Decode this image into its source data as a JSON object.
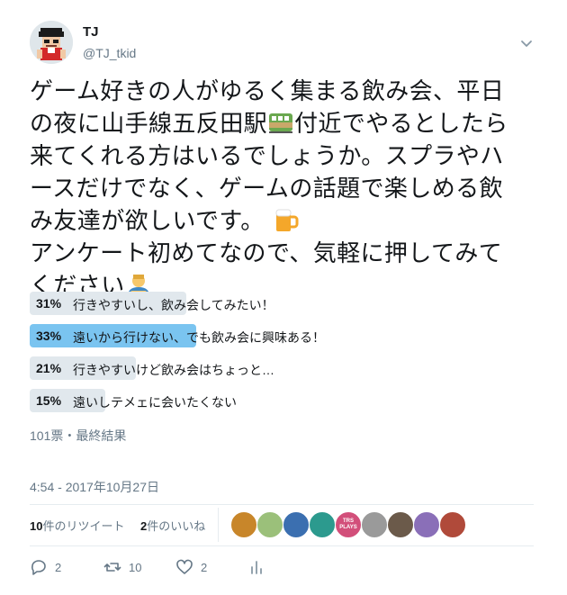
{
  "user": {
    "name": "TJ",
    "handle": "@TJ_tkid"
  },
  "tweet": {
    "lines": [
      "ゲーム好きの人がゆるく集まる飲み会、平日",
      "の夜に山手線五反田駅",
      "付近でやるとしたら",
      "来てくれる方はいるでしょうか。スプラやハ",
      "ースだけでなく、ゲームの話題で楽しめる飲",
      "み友達が欲しいです。",
      "アンケート初めてなので、気軽に押してみて",
      "ください"
    ],
    "emoji_icons": [
      "train-icon",
      "beer-mug-icon",
      "person-bowing-icon"
    ]
  },
  "poll": {
    "options": [
      {
        "percent_label": "31%",
        "percent": 31,
        "label": "行きやすいし、飲み会してみたい！",
        "winner": false
      },
      {
        "percent_label": "33%",
        "percent": 33,
        "label": "遠いから行けない、でも飲み会に興味ある！",
        "winner": true
      },
      {
        "percent_label": "21%",
        "percent": 21,
        "label": "行きやすいけど飲み会はちょっと…",
        "winner": false
      },
      {
        "percent_label": "15%",
        "percent": 15,
        "label": "遠いしテメェに会いたくない",
        "winner": false
      }
    ],
    "meta": "101票・最終結果"
  },
  "timestamp": "4:54 - 2017年10月27日",
  "stats": {
    "retweets_count": "10",
    "retweets_label": "件のリツイート",
    "likes_count": "2",
    "likes_label": "件のいいね",
    "liker_colors": [
      "#c8862a",
      "#9bc07a",
      "#3b6fb0",
      "#2c9a8e",
      "#d24f7a",
      "#9a9a9a",
      "#6b5a4a",
      "#8a6fb8",
      "#b04a3a"
    ],
    "liker_badge_text": "TRS PLAYS"
  },
  "actions": {
    "reply_count": "2",
    "retweet_count": "10",
    "like_count": "2"
  },
  "colors": {
    "poll_winner": "#7ac4f0",
    "poll_default": "#e1e8ed",
    "muted": "#657786"
  }
}
